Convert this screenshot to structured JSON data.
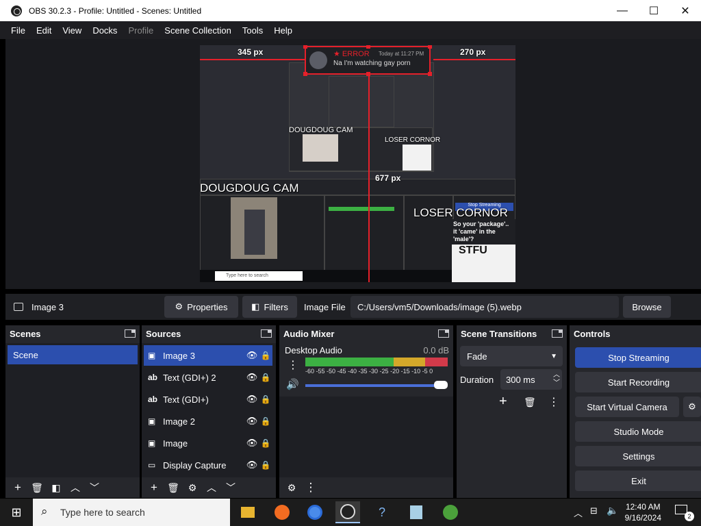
{
  "window": {
    "title": "OBS 30.2.3 - Profile: Untitled - Scenes: Untitled",
    "minimize": "—",
    "maximize": "☐",
    "close": "✕"
  },
  "menu": {
    "items": [
      "File",
      "Edit",
      "View",
      "Docks",
      "Profile",
      "Scene Collection",
      "Tools",
      "Help"
    ]
  },
  "preview": {
    "measure_left": "345 px",
    "measure_right": "270 px",
    "measure_bottom": "677 px",
    "toast_error": "★ ERROR",
    "toast_time": "Today at 11:27 PM",
    "toast_message": "Na I'm watching gay porn",
    "cam_label": "DOUGDOUG CAM",
    "loser_label": "LOSER CORNOR",
    "loser_text": "So your 'package'.. it 'came' in the 'male'?",
    "loser_stfu": "STFU",
    "mini_cam_label": "DOUGDOUG CAM",
    "mini_loser_label": "LOSER CORNOR",
    "mini_search": "Type here to search",
    "mini_stop": "Stop Streaming"
  },
  "source_toolbar": {
    "source_name": "Image 3",
    "properties": "Properties",
    "filters": "Filters",
    "image_file_label": "Image File",
    "image_file_path": "C:/Users/vm5/Downloads/image (5).webp",
    "browse": "Browse"
  },
  "scenes": {
    "title": "Scenes",
    "items": [
      "Scene"
    ]
  },
  "sources": {
    "title": "Sources",
    "items": [
      {
        "label": "Image 3",
        "icon": "image-icon",
        "selected": true
      },
      {
        "label": "Text (GDI+) 2",
        "icon": "text-icon",
        "selected": false
      },
      {
        "label": "Text (GDI+)",
        "icon": "text-icon",
        "selected": false
      },
      {
        "label": "Image 2",
        "icon": "image-icon",
        "selected": false
      },
      {
        "label": "Image",
        "icon": "image-icon",
        "selected": false
      },
      {
        "label": "Display Capture",
        "icon": "display-icon",
        "selected": false
      }
    ]
  },
  "audio_mixer": {
    "title": "Audio Mixer",
    "channel": "Desktop Audio",
    "level": "0.0 dB",
    "scale": "-60 -55 -50 -45 -40 -35 -30 -25 -20 -15 -10 -5 0",
    "volume": 1.0
  },
  "scene_transitions": {
    "title": "Scene Transitions",
    "transition": "Fade",
    "duration_label": "Duration",
    "duration_value": "300 ms"
  },
  "controls": {
    "title": "Controls",
    "stop_streaming": "Stop Streaming",
    "start_recording": "Start Recording",
    "start_virtual_camera": "Start Virtual Camera",
    "studio_mode": "Studio Mode",
    "settings": "Settings",
    "exit": "Exit"
  },
  "taskbar": {
    "search_placeholder": "Type here to search",
    "time": "12:40 AM",
    "date": "9/16/2024",
    "notification_count": "2"
  },
  "colors": {
    "accent": "#2c4fae",
    "dock_bg": "#26272c",
    "red": "#e5202a"
  }
}
